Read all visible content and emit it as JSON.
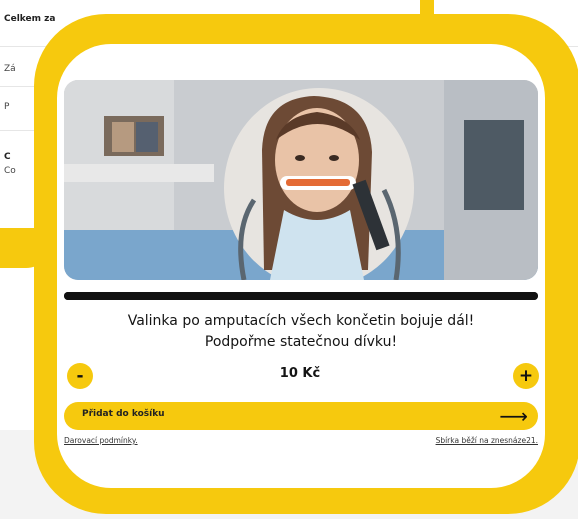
{
  "background": {
    "rows": [
      "Celkem za",
      "Zá",
      "P",
      "C",
      "Co"
    ]
  },
  "campaign": {
    "headline_line1": "Valinka po amputacích všech končetin bojuje dál!",
    "headline_line2": "Podpořme statečnou dívku!",
    "progress": 1.0
  },
  "donation": {
    "decrement_label": "-",
    "increment_label": "+",
    "amount": "10 Kč",
    "add_to_cart_label": "Přidat do košíku",
    "arrow": "⟶"
  },
  "footer": {
    "terms_link": "Darovací podmínky.",
    "platform_link": "Sbírka běží na znesnáze21."
  },
  "colors": {
    "accent": "#f6c90e",
    "text": "#141414",
    "progress": "#111111"
  }
}
